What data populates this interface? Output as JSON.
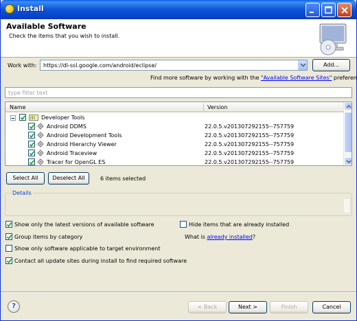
{
  "window": {
    "title": "Install",
    "minimize_icon": "minimize-icon",
    "maximize_icon": "maximize-icon",
    "close_icon": "close-icon"
  },
  "header": {
    "title": "Available Software",
    "subtitle": "Check the items that you wish to install.",
    "graphic": "install-cd-icon"
  },
  "work_with": {
    "label": "Work with:",
    "value": "https://dl-ssl.google.com/android/eclipse/",
    "add_label": "Add...",
    "more_prefix": "Find more software by working with the ",
    "more_link": "\"Available Software Sites\"",
    "more_suffix": " preferences."
  },
  "filter": {
    "placeholder": "type filter text"
  },
  "tree": {
    "columns": [
      "Name",
      "Version"
    ],
    "category": {
      "name": "Developer Tools",
      "checked": true
    },
    "items": [
      {
        "name": "Android DDMS",
        "version": "22.0.5.v201307292155--757759",
        "checked": true
      },
      {
        "name": "Android Development Tools",
        "version": "22.0.5.v201307292155--757759",
        "checked": true
      },
      {
        "name": "Android Hierarchy Viewer",
        "version": "22.0.5.v201307292155--757759",
        "checked": true
      },
      {
        "name": "Android Traceview",
        "version": "22.0.5.v201307292155--757759",
        "checked": true
      },
      {
        "name": "Tracer for OpenGL ES",
        "version": "22.0.5.v201307292155--757759",
        "checked": true
      }
    ]
  },
  "selection": {
    "select_all": "Select All",
    "deselect_all": "Deselect All",
    "status": "6 items selected"
  },
  "details": {
    "label": "Details"
  },
  "options": {
    "latest_versions": {
      "label": "Show only the latest versions of available software",
      "checked": true
    },
    "group_by_category": {
      "label": "Group items by category",
      "checked": true
    },
    "target_env": {
      "label": "Show only software applicable to target environment",
      "checked": false
    },
    "contact_sites": {
      "label": "Contact all update sites during install to find required software",
      "checked": true
    },
    "hide_installed": {
      "label": "Hide items that are already installed",
      "checked": false
    },
    "what_is_prefix": "What is ",
    "what_is_link": "already installed",
    "what_is_suffix": "?"
  },
  "footer": {
    "help_label": "?",
    "back": "< Back",
    "next": "Next >",
    "finish": "Finish",
    "cancel": "Cancel"
  },
  "colors": {
    "titlebar": "#0a55d8",
    "dialog_bg": "#ece9d8",
    "link": "#0000ff",
    "checkbox_mark": "#21a121"
  }
}
